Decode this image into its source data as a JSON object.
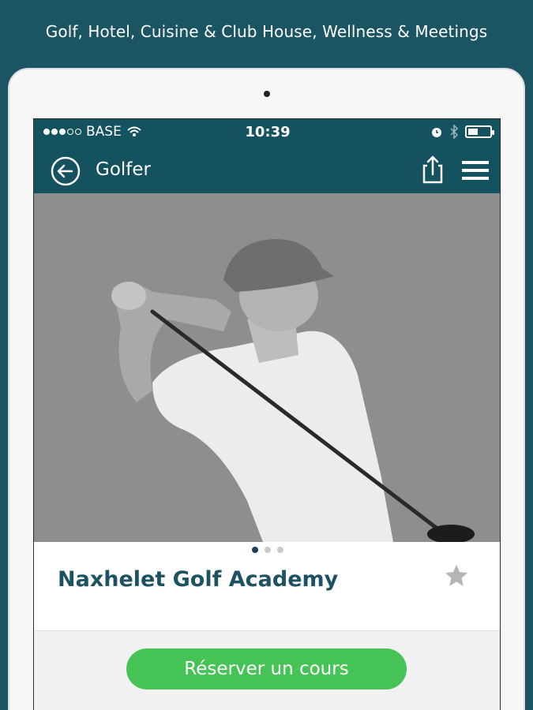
{
  "promo": {
    "caption": "Golf, Hotel, Cuisine & Club House, Wellness & Meetings"
  },
  "status_bar": {
    "carrier": "BASE",
    "time": "10:39",
    "signal_bars_filled": 3,
    "signal_bars_total": 5,
    "battery_level": 0.45
  },
  "nav": {
    "title": "Golfer",
    "back_icon": "back-arrow-circle-icon",
    "share_icon": "share-icon",
    "menu_icon": "hamburger-menu-icon"
  },
  "hero": {
    "image": "golfer-swing-photo",
    "pager_total": 3,
    "pager_active": 0
  },
  "place": {
    "title": "Naxhelet Golf Academy",
    "favorite_icon": "star-icon"
  },
  "actions": {
    "book_label": "Réserver un cours"
  },
  "colors": {
    "background": "#1b5564",
    "nav": "#14525f",
    "accent_green": "#46c355",
    "title_text": "#1d5262"
  }
}
